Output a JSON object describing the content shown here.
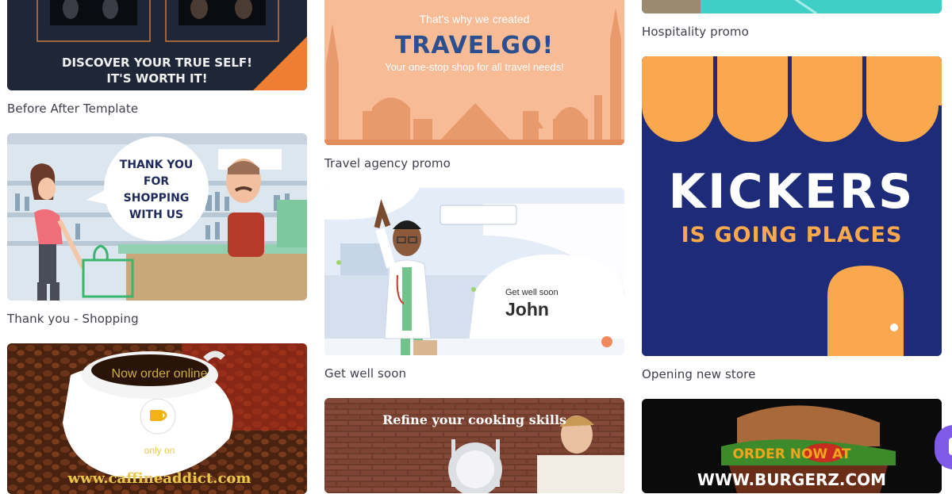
{
  "column1": {
    "before_after": {
      "caption": "Before After Template",
      "line1": "DISCOVER YOUR TRUE SELF!",
      "line2": "IT'S WORTH IT!"
    },
    "thank_you": {
      "caption": "Thank you - Shopping",
      "bubble_lines": [
        "THANK YOU",
        "FOR",
        "SHOPPING",
        "WITH US"
      ]
    },
    "coffee": {
      "text_top": "Now order online",
      "text_bottom": "only on",
      "url": "www.caffineaddict.com"
    }
  },
  "column2": {
    "travel": {
      "caption": "Travel agency promo",
      "line1": "That's why we created",
      "brand": "TRAVELGO!",
      "line3": "Your one-stop shop for all travel needs!"
    },
    "get_well": {
      "caption": "Get well soon",
      "small": "Get well soon",
      "name": "John"
    },
    "cooking": {
      "title": "Refine your cooking skills"
    }
  },
  "column3": {
    "hospitality": {
      "caption": "Hospitality promo"
    },
    "kickers": {
      "caption": "Opening new store",
      "line1": "KICKERS",
      "line2": "IS GOING PLACES"
    },
    "burger": {
      "line1": "ORDER NOW AT",
      "url": "WWW.BURGERZ.COM"
    }
  },
  "colors": {
    "caption": "#3d3f4a",
    "kickers_bg": "#1d2b78",
    "kickers_accent": "#f9a84d",
    "travel_bg": "#f7bb96",
    "travel_brand": "#2b4f8f",
    "chat_button": "#7f5ae8"
  }
}
